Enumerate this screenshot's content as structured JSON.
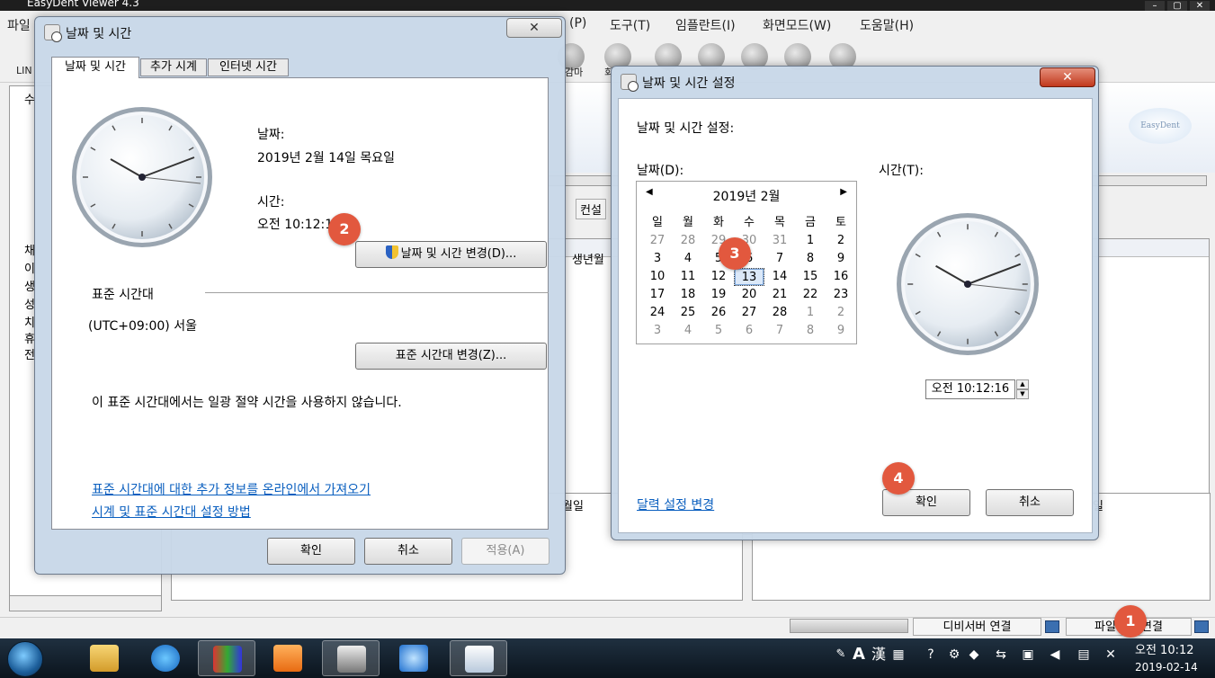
{
  "app": {
    "title": "EasyDent Viewer 4.3",
    "menu": [
      "파일",
      "(P)",
      "도구(T)",
      "임플란트(I)",
      "화면모드(W)",
      "도움말(H)"
    ],
    "toolbar_labels": [
      "LIN",
      "감마",
      "회"
    ],
    "logo_text": "EasyDent",
    "consult_tab": "컨설",
    "birth_header": "생년월",
    "reserved1": "월일",
    "reserved2": "일",
    "status_db": "디비서버 연결",
    "status_file": "파일서버 연결",
    "left_labels": [
      "수",
      "채",
      "이",
      "생",
      "성",
      "치",
      "휴",
      "전"
    ]
  },
  "dialog1": {
    "title": "날짜 및 시간",
    "tabs": [
      "날짜 및 시간",
      "추가 시계",
      "인터넷 시간"
    ],
    "date_label": "날짜:",
    "date_value": "2019년 2월 14일 목요일",
    "time_label": "시간:",
    "time_value": "오전 10:12:16",
    "change_datetime_button": "날짜 및 시간 변경(D)...",
    "timezone_heading": "표준 시간대",
    "timezone_value": "(UTC+09:00) 서울",
    "change_timezone_button": "표준 시간대 변경(Z)...",
    "dst_note": "이 표준 시간대에서는 일광 절약 시간을 사용하지 않습니다.",
    "link_more_info": "표준 시간대에 대한 추가 정보를 온라인에서 가져오기",
    "link_how_to": "시계 및 표준 시간대 설정 방법",
    "ok": "확인",
    "cancel": "취소",
    "apply": "적용(A)",
    "close_glyph": "✕"
  },
  "dialog2": {
    "title": "날짜 및 시간 설정",
    "heading": "날짜 및 시간 설정:",
    "date_label": "날짜(D):",
    "time_label": "시간(T):",
    "calendar_month": "2019년 2월",
    "weekdays": [
      "일",
      "월",
      "화",
      "수",
      "목",
      "금",
      "토"
    ],
    "weeks": [
      [
        "27",
        "28",
        "29",
        "30",
        "31",
        "1",
        "2"
      ],
      [
        "3",
        "4",
        "5",
        "6",
        "7",
        "8",
        "9"
      ],
      [
        "10",
        "11",
        "12",
        "13",
        "14",
        "15",
        "16"
      ],
      [
        "17",
        "18",
        "19",
        "20",
        "21",
        "22",
        "23"
      ],
      [
        "24",
        "25",
        "26",
        "27",
        "28",
        "1",
        "2"
      ],
      [
        "3",
        "4",
        "5",
        "6",
        "7",
        "8",
        "9"
      ]
    ],
    "selected_day": "13",
    "time_value": "오전 10:12:16",
    "calendar_settings_link": "달력 설정 변경",
    "ok": "확인",
    "cancel": "취소",
    "close_glyph": "✕"
  },
  "markers": [
    "1",
    "2",
    "3",
    "4"
  ],
  "taskbar": {
    "tray_text": "A",
    "tray_hanja": "漢",
    "clock_time": "오전 10:12",
    "clock_date": "2019-02-14"
  },
  "colors": {
    "marker": "#e2583e",
    "link": "#0a5fbf",
    "dialog_frame": "#c8d7e8"
  }
}
